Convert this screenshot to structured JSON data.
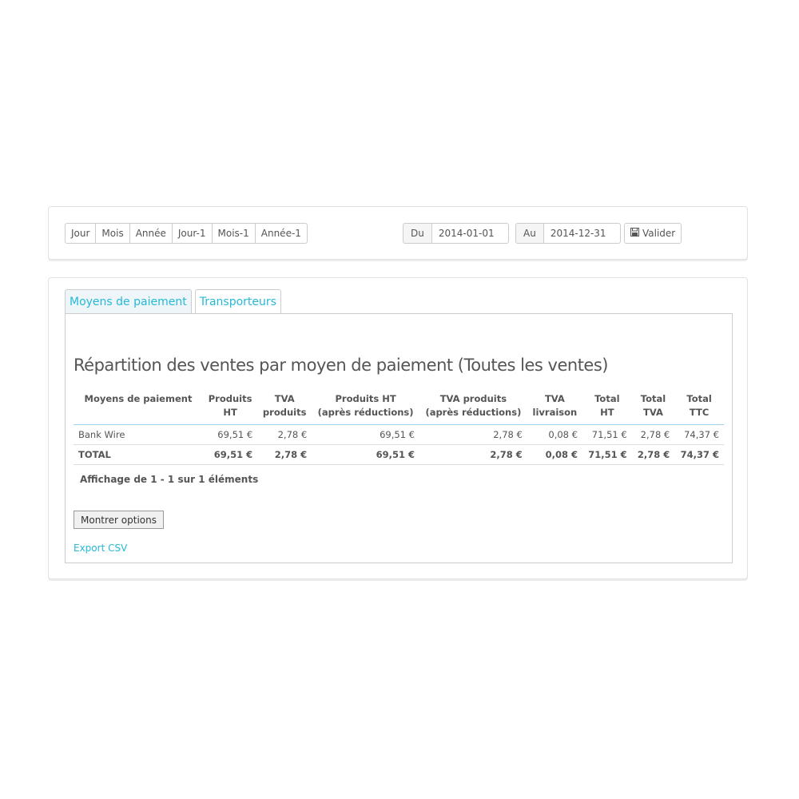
{
  "filters": {
    "period_buttons": [
      "Jour",
      "Mois",
      "Année",
      "Jour-1",
      "Mois-1",
      "Année-1"
    ],
    "from_label": "Du",
    "from_value": "2014-01-01",
    "to_label": "Au",
    "to_value": "2014-12-31",
    "validate_label": "Valider",
    "validate_icon": "save-icon"
  },
  "tabs": [
    {
      "label": "Moyens de paiement",
      "active": true
    },
    {
      "label": "Transporteurs",
      "active": false
    }
  ],
  "report": {
    "title": "Répartition des ventes par moyen de paiement (Toutes les ventes)",
    "columns": [
      [
        "Moyens de paiement"
      ],
      [
        "Produits",
        "HT"
      ],
      [
        "TVA",
        "produits"
      ],
      [
        "Produits HT",
        "(après réductions)"
      ],
      [
        "TVA produits",
        "(après réductions)"
      ],
      [
        "TVA",
        "livraison"
      ],
      [
        "Total",
        "HT"
      ],
      [
        "Total",
        "TVA"
      ],
      [
        "Total",
        "TTC"
      ]
    ],
    "rows": [
      [
        "Bank Wire",
        "69,51 €",
        "2,78 €",
        "69,51 €",
        "2,78 €",
        "0,08 €",
        "71,51 €",
        "2,78 €",
        "74,37 €"
      ]
    ],
    "total_row": [
      "TOTAL",
      "69,51 €",
      "2,78 €",
      "69,51 €",
      "2,78 €",
      "0,08 €",
      "71,51 €",
      "2,78 €",
      "74,37 €"
    ],
    "pagination_text": "Affichage de 1 - 1 sur 1 éléments",
    "options_button": "Montrer options",
    "export_link": "Export CSV"
  },
  "colors": {
    "accent": "#25b9d7",
    "border": "#cccccc",
    "text": "#555555"
  }
}
